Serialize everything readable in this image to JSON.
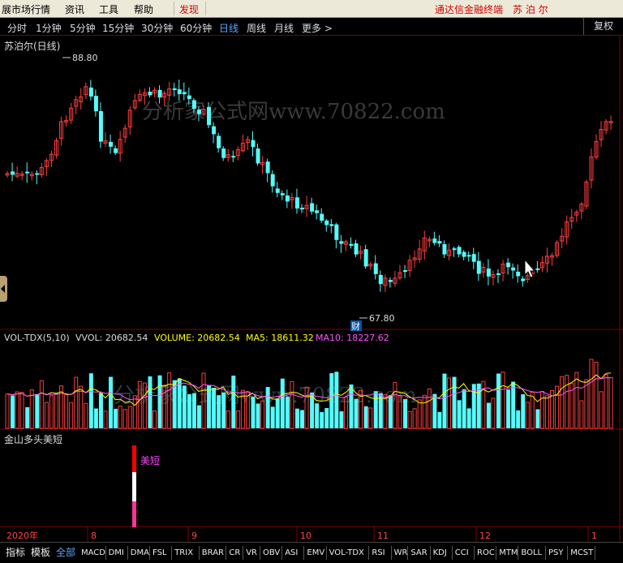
{
  "menu": {
    "items": [
      "展市场行情",
      "资讯",
      "工具",
      "帮助"
    ],
    "discover": "发现",
    "terminal_title": "通达信金融终端",
    "stock_name": "苏 泊 尔"
  },
  "periods": {
    "items": [
      "分时",
      "1分钟",
      "5分钟",
      "15分钟",
      "30分钟",
      "60分钟",
      "日线",
      "周线",
      "月线",
      "更多 >"
    ],
    "active": "日线",
    "fuquan": "复权"
  },
  "main_chart": {
    "title": "苏泊尔(日线)",
    "high_label": "88.80",
    "low_label": "67.80",
    "cai_icon": "财",
    "watermark": "分析家公式网www.70822.com"
  },
  "volume_panel": {
    "name": "VOL-TDX(5,10)",
    "vvol": "VVOL: 20682.54",
    "volume": "VOLUME: 20682.54",
    "ma5": "MA5: 18611.32",
    "ma10": "MA10: 18227.62",
    "watermark": "分析家公式网www.70822.com"
  },
  "indicator_panel": {
    "name": "金山多头美短",
    "signal_label": "美短"
  },
  "x_axis": {
    "labels": [
      "2020年",
      "8",
      "9",
      "10",
      "11",
      "12",
      "1"
    ]
  },
  "bottom_tabs": {
    "tabs": [
      "指标",
      "模板",
      "全部"
    ],
    "active": "全部",
    "indicators": [
      "MACD",
      "DMI",
      "DMA",
      "FSL",
      "TRIX",
      "BRAR",
      "CR",
      "VR",
      "OBV",
      "ASI",
      "EMV",
      "VOL-TDX",
      "RSI",
      "WR",
      "SAR",
      "KDJ",
      "CCI",
      "ROC",
      "MTM",
      "BOLL",
      "PSY",
      "MCST"
    ]
  },
  "colors": {
    "up": "#ff3c3c",
    "down": "#54fcfc",
    "ma5": "#ffff00",
    "ma10": "#ff55ff",
    "grid": "#800000",
    "signal_red": "#ff0000",
    "signal_white": "#ffffff",
    "signal_pink": "#ff3399"
  }
}
